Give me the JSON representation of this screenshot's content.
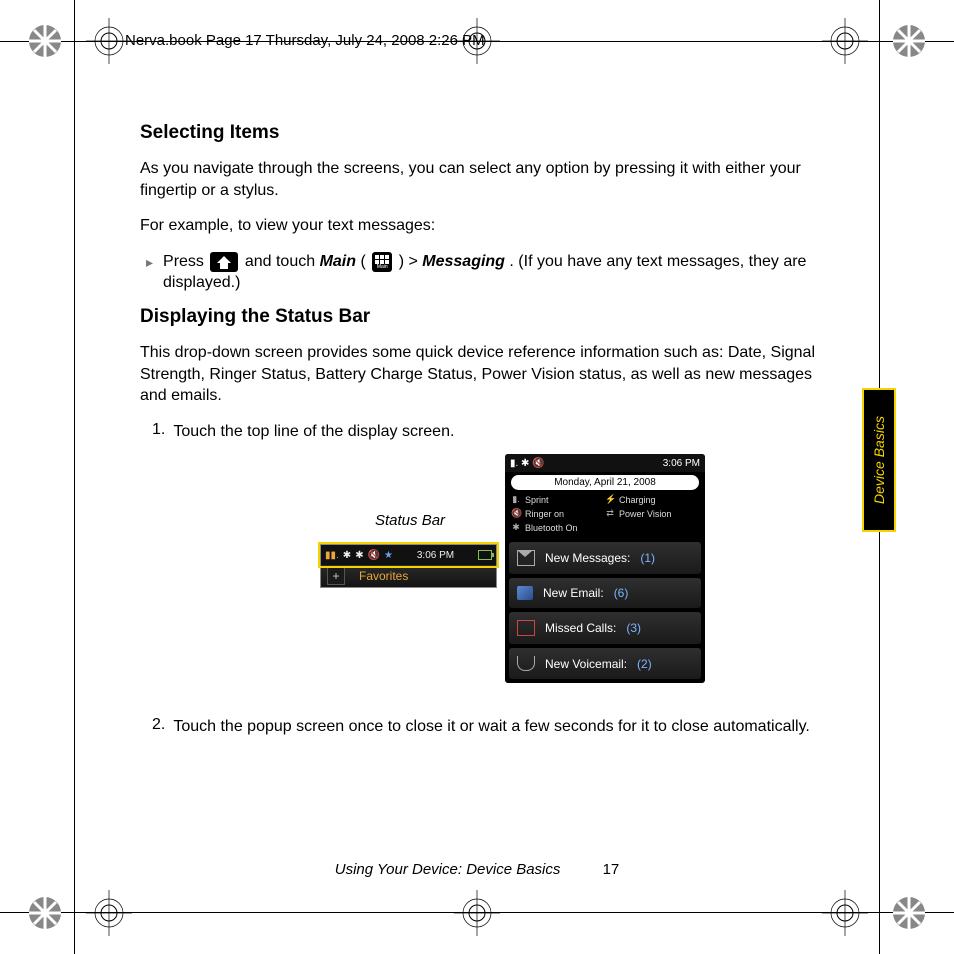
{
  "header": "Nerva.book  Page 17  Thursday, July 24, 2008  2:26 PM",
  "section1": {
    "title": "Selecting Items",
    "p1": "As you navigate through the screens, you can select any option by pressing it with either your fingertip or a stylus.",
    "p2": "For example, to view your text messages:",
    "bullet_pre": "Press ",
    "bullet_mid1": " and touch ",
    "main_label": "Main",
    "bullet_mid2": " ( ",
    "bullet_mid3": " ) > ",
    "messaging_label": "Messaging",
    "bullet_post": ". (If you have any text messages, they are displayed.)"
  },
  "section2": {
    "title": "Displaying the Status Bar",
    "p1": "This drop-down screen provides some quick device reference information such as: Date, Signal Strength, Ringer Status, Battery Charge Status, Power Vision status, as well as new messages and emails.",
    "step1_num": "1.",
    "step1": "Touch the top line of the display screen.",
    "step2_num": "2.",
    "step2": "Touch the popup screen once to close it or wait a few seconds for it to close automatically."
  },
  "figure": {
    "status_bar_label": "Status Bar",
    "small": {
      "time": "3:06 PM",
      "favorites": "Favorites",
      "plus": "+"
    },
    "large": {
      "time": "3:06 PM",
      "date": "Monday, April 21, 2008",
      "status": {
        "sprint": "Sprint",
        "charging": "Charging",
        "ringer": "Ringer on",
        "pv": "Power Vision",
        "bt": "Bluetooth On"
      },
      "rows": {
        "msgs_label": "New Messages:",
        "msgs_count": "(1)",
        "email_label": "New Email:",
        "email_count": "(6)",
        "calls_label": "Missed Calls:",
        "calls_count": "(3)",
        "vm_label": "New Voicemail:",
        "vm_count": "(2)"
      }
    }
  },
  "side_tab": "Device Basics",
  "footer": {
    "title": "Using Your Device: Device Basics",
    "page": "17"
  }
}
